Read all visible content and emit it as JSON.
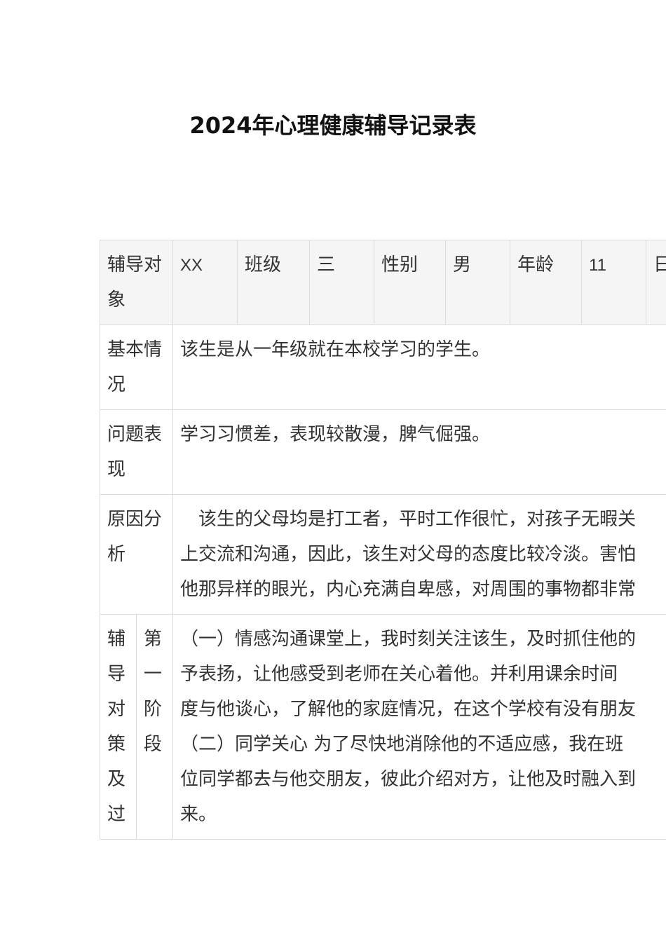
{
  "title": "2024年心理健康辅导记录表",
  "header_row": {
    "target_label": "辅导对象",
    "name_value": "XX",
    "class_label": "班级",
    "class_value": "三",
    "gender_label": "性别",
    "gender_value": "男",
    "age_label": "年龄",
    "age_value": "11",
    "date_label_partial": "日"
  },
  "rows": {
    "basic": {
      "label": "基本情况",
      "text": "该生是从一年级就在本校学习的学生。"
    },
    "problem": {
      "label": "问题表现",
      "text": "学习习惯差，表现较散漫，脾气倔强。"
    },
    "cause": {
      "label": "原因分析",
      "lines": [
        "该生的父母均是打工者，平时工作很忙，对孩子无暇关",
        "上交流和沟通，因此，该生对父母的态度比较冷淡。害怕",
        "他那异样的眼光，内心充满自卑感，对周围的事物都非常"
      ]
    },
    "strategy": {
      "label": "辅导对策及过",
      "stage_label": "第一阶段",
      "lines": [
        "（一）情感沟通课堂上，我时刻关注该生，及时抓住他的",
        "予表扬，让他感受到老师在关心着他。并利用课余时间",
        "度与他谈心，了解他的家庭情况，在这个学校有没有朋友",
        "（二）同学关心 为了尽快地消除他的不适应感，我在班",
        "位同学都去与他交朋友，彼此介绍对方，让他及时融入到",
        "来。"
      ]
    }
  }
}
